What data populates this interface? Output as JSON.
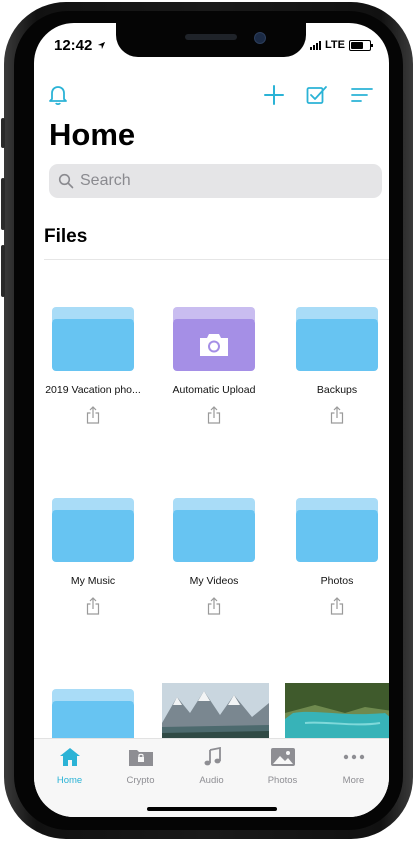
{
  "status": {
    "time": "12:42",
    "carrier": "LTE"
  },
  "header": {
    "title": "Home"
  },
  "search": {
    "placeholder": "Search"
  },
  "files": {
    "section_title": "Files",
    "items": [
      {
        "label": "2019 Vacation pho...",
        "type": "folder",
        "color": "blue"
      },
      {
        "label": "Automatic Upload",
        "type": "folder",
        "color": "purple"
      },
      {
        "label": "Backups",
        "type": "folder",
        "color": "blue"
      },
      {
        "label": "My Music",
        "type": "folder",
        "color": "blue"
      },
      {
        "label": "My Videos",
        "type": "folder",
        "color": "blue"
      },
      {
        "label": "Photos",
        "type": "folder",
        "color": "blue"
      }
    ]
  },
  "tabbar": {
    "items": [
      {
        "label": "Home",
        "icon": "home-icon",
        "active": true
      },
      {
        "label": "Crypto",
        "icon": "lock-folder-icon",
        "active": false
      },
      {
        "label": "Audio",
        "icon": "music-note-icon",
        "active": false
      },
      {
        "label": "Photos",
        "icon": "photo-icon",
        "active": false
      },
      {
        "label": "More",
        "icon": "more-dots-icon",
        "active": false
      }
    ]
  },
  "colors": {
    "accent": "#2bb3d6",
    "folder_blue": "#67c4f2",
    "folder_purple": "#a58fe6"
  }
}
